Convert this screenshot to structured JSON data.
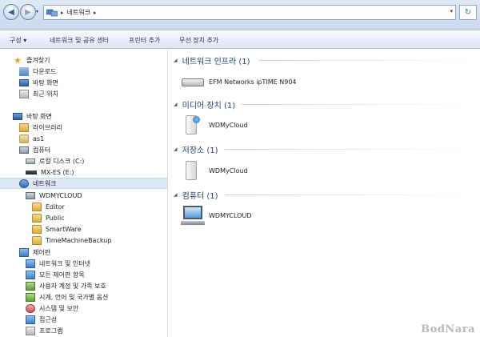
{
  "address_bar": {
    "breadcrumb": [
      "네트워크"
    ],
    "back_icon": "back-arrow-icon",
    "forward_icon": "forward-arrow-icon"
  },
  "toolbar": {
    "items": [
      "구성 ▾",
      "네트워크 및 공유 센터",
      "프린터 추가",
      "무선 장치 추가"
    ]
  },
  "nav": {
    "favorites_title": "즐겨찾기",
    "favorites": [
      "다운로드",
      "바탕 화면",
      "최근 위치"
    ],
    "desktop": "바탕 화면",
    "library": "라이브러리",
    "user": "as1",
    "computer": "컴퓨터",
    "drives": [
      "로컬 디스크 (C:)",
      "MX-ES (E:)"
    ],
    "network": "네트워크",
    "network_device": "WDMYCLOUD",
    "shares": [
      "Editor",
      "Public",
      "SmartWare",
      "TimeMachineBackup"
    ],
    "control_panel": "제어판",
    "control_items": [
      "네트워크 및 인터넷",
      "모든 제어판 항목",
      "사용자 계정 및 가족 보호",
      "시계, 언어 및 국가별 옵션",
      "시스템 및 보안",
      "접근성",
      "프로그램"
    ]
  },
  "content": {
    "groups": [
      {
        "header": "네트워크 인프라 (1)",
        "device": "EFM Networks ipTIME N904",
        "icon": "router-icon"
      },
      {
        "header": "미디어 장치 (1)",
        "device": "WDMyCloud",
        "icon": "media-nas-icon"
      },
      {
        "header": "저장소 (1)",
        "device": "WDMyCloud",
        "icon": "storage-nas-icon"
      },
      {
        "header": "컴퓨터 (1)",
        "device": "WDMYCLOUD",
        "icon": "computer-icon"
      }
    ]
  },
  "watermark": "BodNara"
}
